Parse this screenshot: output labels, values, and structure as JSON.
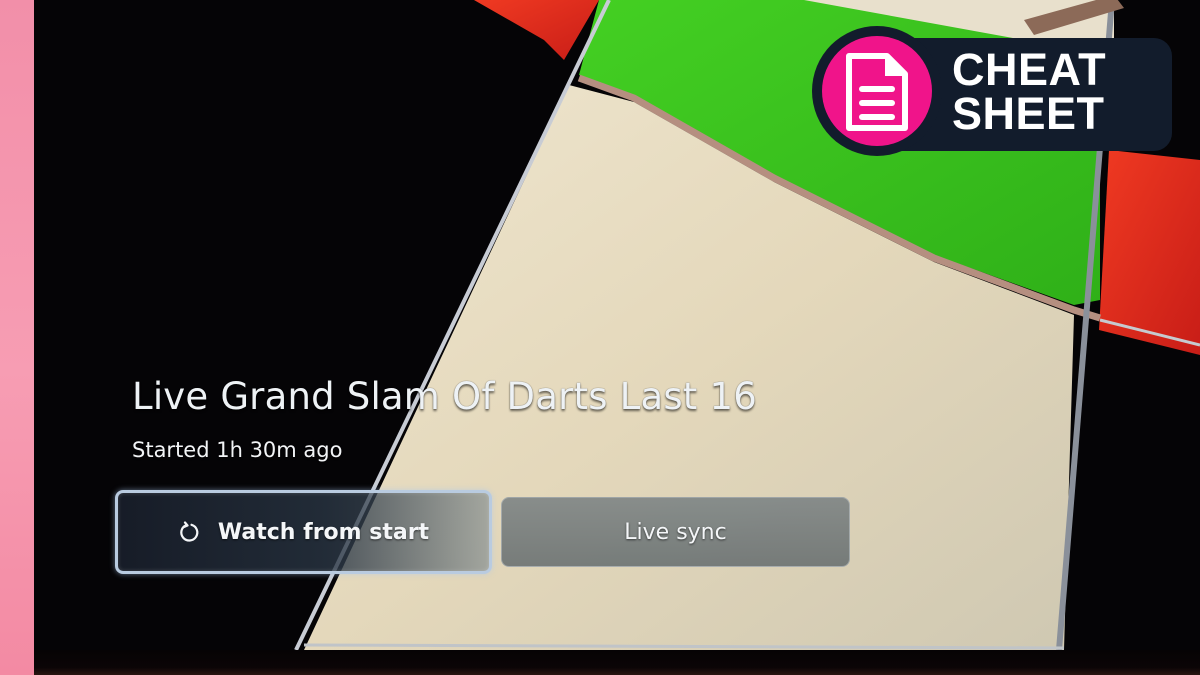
{
  "program": {
    "title": "Live Grand Slam Of Darts Last 16",
    "subtitle": "Started 1h 30m ago"
  },
  "actions": {
    "watch_from_start": {
      "label": "Watch from start",
      "icon": "restart-icon",
      "focused": true
    },
    "live_sync": {
      "label": "Live sync",
      "focused": false
    }
  },
  "badge": {
    "icon": "document-icon",
    "line1": "CHEAT",
    "line2": "SHEET"
  },
  "colors": {
    "badge_background": "#121c2c",
    "badge_accent": "#f0148a",
    "board_green": "#3ec81e",
    "board_red": "#e0261c",
    "board_cream": "#e6dcc4",
    "board_black": "#050406",
    "wall_pink": "#f28fa9",
    "focus_border": "#b9cbe0"
  }
}
